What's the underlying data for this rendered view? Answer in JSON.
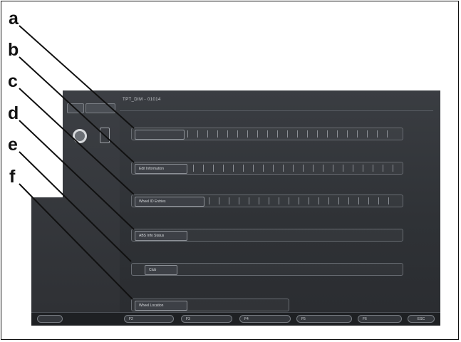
{
  "callout_letters": [
    "a",
    "b",
    "c",
    "d",
    "e",
    "f"
  ],
  "screen": {
    "title": "TPT_DIM - 01014",
    "side_text": "",
    "rows": [
      {
        "label": ""
      },
      {
        "label": "Edit Information"
      },
      {
        "label": "Wheel ID Entries"
      },
      {
        "label": "ABS Info Status"
      },
      {
        "label": "Club"
      },
      {
        "label": "Wheel Location"
      }
    ]
  },
  "bottom_bar": {
    "keys": [
      "",
      "F2",
      "F3",
      "F4",
      "F5",
      "F6",
      "ESC"
    ]
  },
  "colors": {
    "screen_bg": "#33363a",
    "accent": "#d7d9dc",
    "callout_line": "#111111"
  }
}
